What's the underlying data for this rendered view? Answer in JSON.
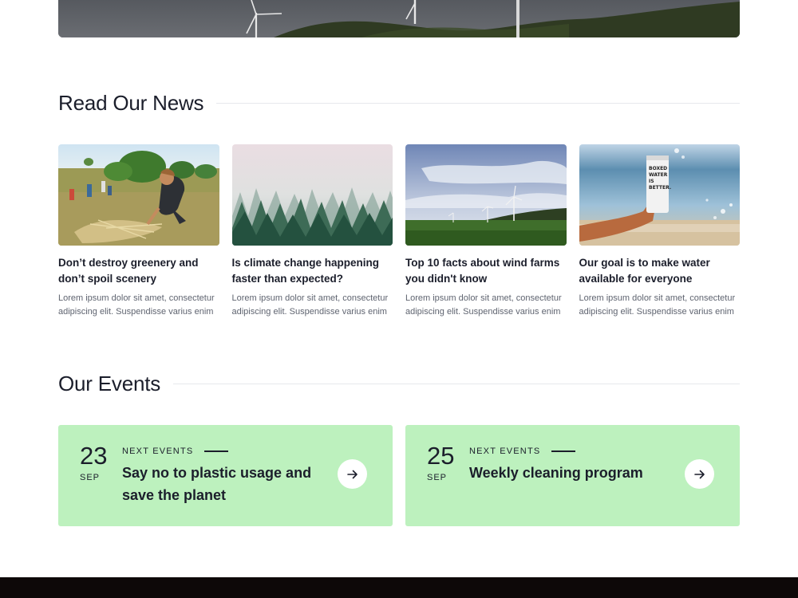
{
  "hero": {
    "image_alt": "wind-turbines-landscape"
  },
  "news": {
    "heading": "Read Our News",
    "items": [
      {
        "title": "Don’t destroy greenery and don’t spoil scenery",
        "excerpt": "Lorem ipsum dolor sit amet, consectetur adipiscing elit. Suspendisse varius enim",
        "image": "volunteer-planting-photo"
      },
      {
        "title": " Is climate change happening faster than expected?",
        "excerpt": "Lorem ipsum dolor sit amet, consectetur adipiscing elit. Suspendisse varius enim",
        "image": "foggy-forest-photo"
      },
      {
        "title": "Top 10 facts about wind farms you didn't know",
        "excerpt": "Lorem ipsum dolor sit amet, consectetur adipiscing elit. Suspendisse varius enim",
        "image": "wind-farm-photo"
      },
      {
        "title": "Our goal is to make water available for everyone",
        "excerpt": "Lorem ipsum dolor sit amet, consectetur adipiscing elit. Suspendisse varius enim",
        "image": "water-carton-beach-photo"
      }
    ]
  },
  "events": {
    "heading": "Our Events",
    "items": [
      {
        "day": "23",
        "month": "SEP",
        "kicker": "NEXT EVENTS",
        "title": "Say no to plastic usage and save the planet",
        "icon": "arrow-right-icon"
      },
      {
        "day": "25",
        "month": "SEP",
        "kicker": "NEXT EVENTS",
        "title": "Weekly cleaning program",
        "icon": "arrow-right-icon"
      }
    ]
  },
  "colors": {
    "event_card_bg": "#bdf1be",
    "text_primary": "#1b1e2b",
    "text_muted": "#5f6470",
    "footer_bg": "#0d0808"
  }
}
